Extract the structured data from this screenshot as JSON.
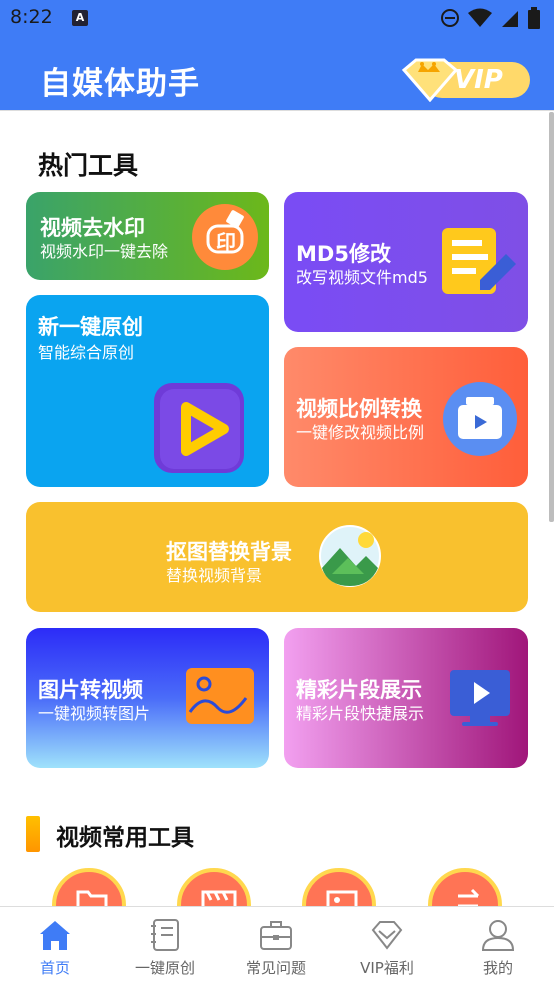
{
  "status_bar": {
    "time": "8:22",
    "notification_icon": "a-icon"
  },
  "app_bar": {
    "title": "自媒体助手",
    "vip_badge": "VIP"
  },
  "hot_tools": {
    "title": "热门工具",
    "cards": [
      {
        "title": "视频去水印",
        "subtitle": "视频水印一键去除",
        "icon": "stamp-icon",
        "badge": "印"
      },
      {
        "title": "MD5修改",
        "subtitle": "改写视频文件md5",
        "icon": "document-edit-icon"
      },
      {
        "title": "新一键原创",
        "subtitle": "智能综合原创",
        "icon": "play-icon"
      },
      {
        "title": "视频比例转换",
        "subtitle": "一键修改视频比例",
        "icon": "video-ratio-icon"
      },
      {
        "title": "抠图替换背景",
        "subtitle": "替换视频背景",
        "icon": "landscape-icon"
      },
      {
        "title": "图片转视频",
        "subtitle": "一键视频转图片",
        "icon": "image-icon"
      },
      {
        "title": "精彩片段展示",
        "subtitle": "精彩片段快捷展示",
        "icon": "monitor-play-icon"
      }
    ]
  },
  "video_tools": {
    "title": "视频常用工具"
  },
  "bottom_nav": {
    "items": [
      {
        "label": "首页",
        "icon": "home-icon",
        "active": true
      },
      {
        "label": "一键原创",
        "icon": "notebook-icon",
        "active": false
      },
      {
        "label": "常见问题",
        "icon": "briefcase-icon",
        "active": false
      },
      {
        "label": "VIP福利",
        "icon": "diamond-icon",
        "active": false
      },
      {
        "label": "我的",
        "icon": "user-icon",
        "active": false
      }
    ]
  },
  "colors": {
    "primary": "#3f7cf6",
    "accent_orange": "#ff7455",
    "gold": "#ffd84e"
  }
}
